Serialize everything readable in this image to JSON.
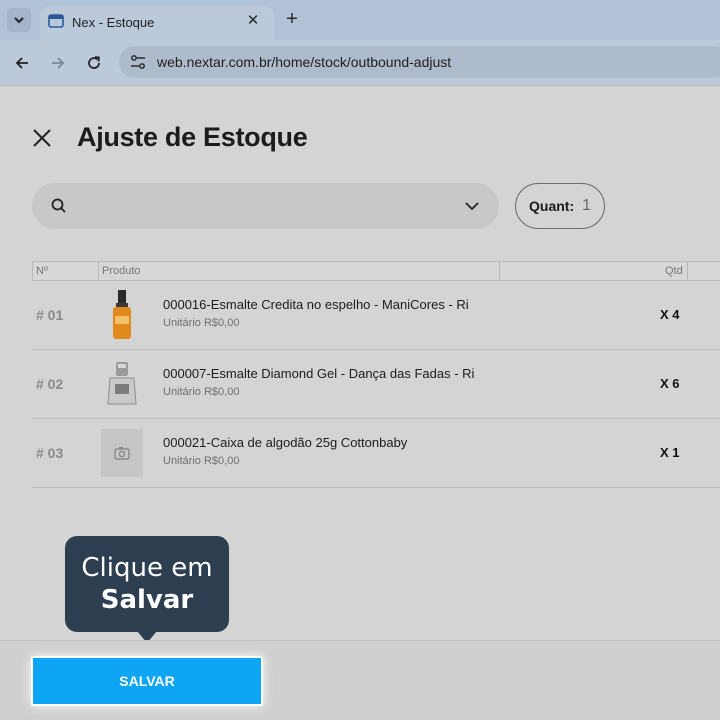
{
  "browser": {
    "tab_title": "Nex - Estoque",
    "url": "web.nextar.com.br/home/stock/outbound-adjust"
  },
  "header": {
    "title": "Ajuste de Estoque"
  },
  "search": {
    "placeholder": ""
  },
  "quant": {
    "label": "Quant:",
    "value": "1"
  },
  "table": {
    "columns": [
      "Nº",
      "Produto",
      "Qtd"
    ],
    "rows": [
      {
        "num": "# 01",
        "name": "000016-Esmalte Credita no espelho - ManiCores - Ri",
        "price": "Unitário R$0,00",
        "qty": "X 4",
        "image": "orange-polish-bottle"
      },
      {
        "num": "# 02",
        "name": "000007-Esmalte Diamond Gel - Dança das Fadas - Ri",
        "price": "Unitário R$0,00",
        "qty": "X 6",
        "image": "silver-polish-bottle"
      },
      {
        "num": "# 03",
        "name": "000021-Caixa de algodão 25g Cottonbaby",
        "price": "Unitário R$0,00",
        "qty": "X 1",
        "image": "camera-placeholder-icon"
      }
    ]
  },
  "tooltip": {
    "line1": "Clique em",
    "line2": "Salvar"
  },
  "footer": {
    "save_label": "SALVAR"
  },
  "colors": {
    "accent": "#0ea5f5",
    "tooltip_bg": "#2d3e50"
  }
}
